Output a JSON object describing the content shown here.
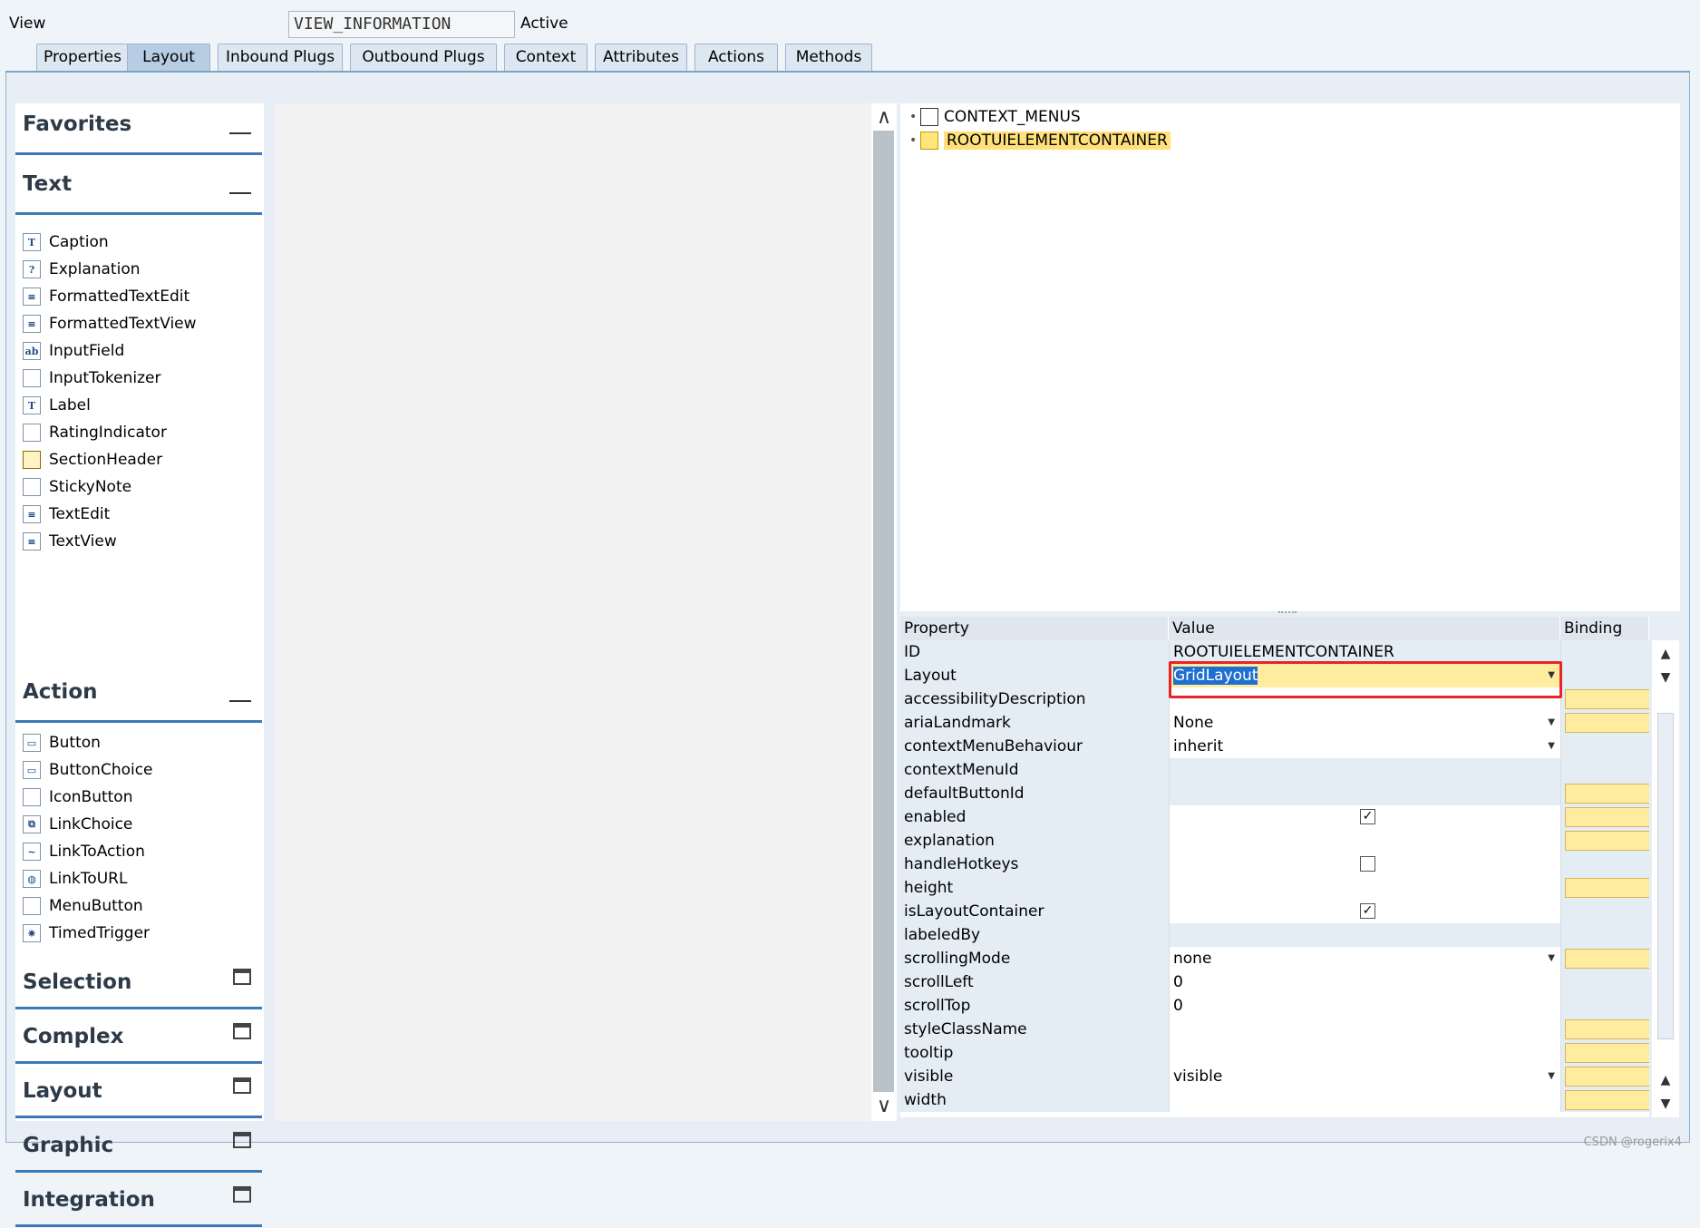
{
  "header": {
    "view_label": "View",
    "view_name": "VIEW_INFORMATION",
    "status": "Active"
  },
  "tabs": [
    "Properties",
    "Layout",
    "Inbound Plugs",
    "Outbound Plugs",
    "Context",
    "Attributes",
    "Actions",
    "Methods"
  ],
  "active_tab": "Layout",
  "palette": {
    "favorites": "Favorites",
    "text_section": "Text",
    "text_items": [
      "Caption",
      "Explanation",
      "FormattedTextEdit",
      "FormattedTextView",
      "InputField",
      "InputTokenizer",
      "Label",
      "RatingIndicator",
      "SectionHeader",
      "StickyNote",
      "TextEdit",
      "TextView"
    ],
    "action_section": "Action",
    "action_items": [
      "Button",
      "ButtonChoice",
      "IconButton",
      "LinkChoice",
      "LinkToAction",
      "LinkToURL",
      "MenuButton",
      "TimedTrigger"
    ],
    "collapsed_sections": [
      "Selection",
      "Complex",
      "Layout",
      "Graphic",
      "Integration"
    ]
  },
  "tree": {
    "items": [
      "CONTEXT_MENUS",
      "ROOTUIELEMENTCONTAINER"
    ],
    "selected": "ROOTUIELEMENTCONTAINER"
  },
  "properties": {
    "headers": [
      "Property",
      "Value",
      "Binding"
    ],
    "rows": [
      {
        "name": "ID",
        "value": "ROOTUIELEMENTCONTAINER",
        "kind": "ro",
        "binding": false
      },
      {
        "name": "Layout",
        "value": "GridLayout",
        "kind": "select",
        "binding": false,
        "highlight": true
      },
      {
        "name": "accessibilityDescription",
        "value": "",
        "kind": "text",
        "binding": true
      },
      {
        "name": "ariaLandmark",
        "value": "None",
        "kind": "select",
        "binding": true
      },
      {
        "name": "contextMenuBehaviour",
        "value": "inherit",
        "kind": "select",
        "binding": false
      },
      {
        "name": "contextMenuId",
        "value": "",
        "kind": "ro",
        "binding": false
      },
      {
        "name": "defaultButtonId",
        "value": "",
        "kind": "ro",
        "binding": true
      },
      {
        "name": "enabled",
        "value": "",
        "kind": "check",
        "checked": true,
        "binding": true
      },
      {
        "name": "explanation",
        "value": "",
        "kind": "text",
        "binding": true
      },
      {
        "name": "handleHotkeys",
        "value": "",
        "kind": "check",
        "checked": false,
        "binding": false
      },
      {
        "name": "height",
        "value": "",
        "kind": "text",
        "binding": true
      },
      {
        "name": "isLayoutContainer",
        "value": "",
        "kind": "check",
        "checked": true,
        "binding": false
      },
      {
        "name": "labeledBy",
        "value": "",
        "kind": "ro",
        "binding": false
      },
      {
        "name": "scrollingMode",
        "value": "none",
        "kind": "select",
        "binding": true
      },
      {
        "name": "scrollLeft",
        "value": "0",
        "kind": "text",
        "binding": false
      },
      {
        "name": "scrollTop",
        "value": "0",
        "kind": "text",
        "binding": false
      },
      {
        "name": "styleClassName",
        "value": "",
        "kind": "text",
        "binding": true
      },
      {
        "name": "tooltip",
        "value": "",
        "kind": "text",
        "binding": true
      },
      {
        "name": "visible",
        "value": "visible",
        "kind": "select",
        "binding": true
      },
      {
        "name": "width",
        "value": "",
        "kind": "text",
        "binding": true
      }
    ]
  },
  "watermark": "CSDN @rogerix4",
  "colors": {
    "accent": "#3c7ab6",
    "binding_field": "#ffec9e",
    "highlight_border": "#e8242b",
    "selected_node": "#ffe07a"
  }
}
